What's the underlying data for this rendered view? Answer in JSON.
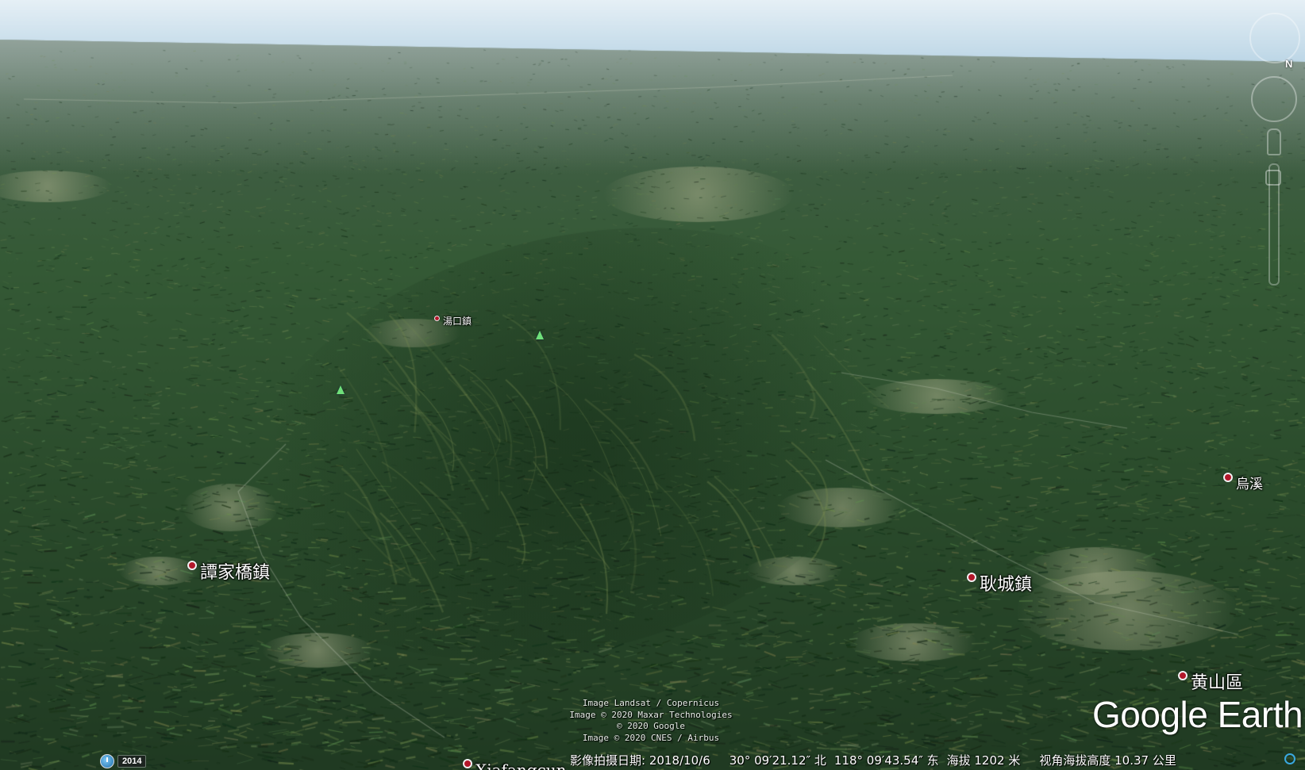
{
  "map": {
    "places": [
      {
        "id": "tanjiaqiao",
        "label": "譚家橋鎮",
        "size": "large",
        "pin": "normal"
      },
      {
        "id": "gengcheng",
        "label": "耿城鎮",
        "size": "large",
        "pin": "normal"
      },
      {
        "id": "huangshan",
        "label": "黄山區",
        "size": "large",
        "pin": "normal"
      },
      {
        "id": "wuxi",
        "label": "烏溪",
        "size": "medium",
        "pin": "normal"
      },
      {
        "id": "tangkou",
        "label": "湯口鎮",
        "size": "small",
        "pin": "small"
      },
      {
        "id": "xiafangcun",
        "label": "Xiafangcun",
        "size": "large",
        "pin": "normal"
      }
    ],
    "peak_markers": [
      "peak-icon",
      "peak-icon"
    ],
    "attribution": [
      "Image Landsat / Copernicus",
      "Image © 2020 Maxar Technologies",
      "© 2020 Google",
      "Image © 2020 CNES / Airbus"
    ],
    "logo": "Google Earth",
    "history": {
      "year": "2014",
      "icon": "historical-imagery-clock-icon"
    },
    "status": {
      "imagery_date": "影像拍摄日期: 2018/10/6",
      "latitude": "30° 09′21.12″ 北",
      "longitude": "118° 09′43.54″ 东",
      "elevation": "海拔 1202 米",
      "eye_altitude": "视角海拔高度 10.37 公里"
    },
    "colors": {
      "pin": "#b3172a",
      "peak": "#6fe07a",
      "sky": "#cfe3ef",
      "forest": "#2c4a2c"
    }
  }
}
